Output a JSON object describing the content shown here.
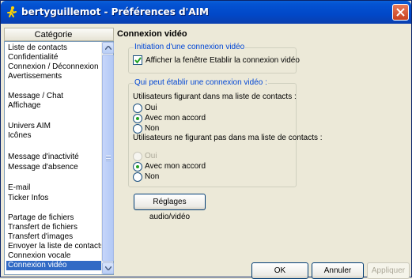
{
  "window": {
    "title": "bertyguillemot - Préférences d'AIM"
  },
  "category": {
    "header": "Catégorie",
    "items": [
      "Liste de contacts",
      "Confidentialité",
      "Connexion / Déconnexion",
      "Avertissements",
      "Message / Chat",
      "Affichage",
      "Univers AIM",
      "Icônes",
      "Message d'inactivité",
      "Message d'absence",
      "E-mail",
      "Ticker Infos",
      "Partage de fichiers",
      "Transfert de fichiers",
      "Transfert d'images",
      "Envoyer la liste de contacts",
      "Connexion vocale",
      "Connexion vidéo"
    ],
    "selected": "Connexion vidéo"
  },
  "panel": {
    "title": "Connexion vidéo",
    "initiation": {
      "label": "Initiation d'une connexion vidéo",
      "checkbox_label": "Afficher la fenêtre Etablir la connexion vidéo",
      "checked": true
    },
    "who": {
      "label": "Qui peut établir une connexion vidéo :",
      "in_list_label": "Utilisateurs figurant dans ma liste de contacts :",
      "in_list_options": [
        "Oui",
        "Avec mon accord",
        "Non"
      ],
      "in_list_selected": "Avec mon accord",
      "not_in_list_label": "Utilisateurs ne figurant pas dans ma liste de contacts :",
      "not_in_list_options": [
        "Oui",
        "Avec mon accord",
        "Non"
      ],
      "not_in_list_selected": "Avec mon accord"
    },
    "av_settings_button": "Réglages audio/vidéo"
  },
  "footer": {
    "ok": "OK",
    "cancel": "Annuler",
    "apply": "Appliquer"
  }
}
